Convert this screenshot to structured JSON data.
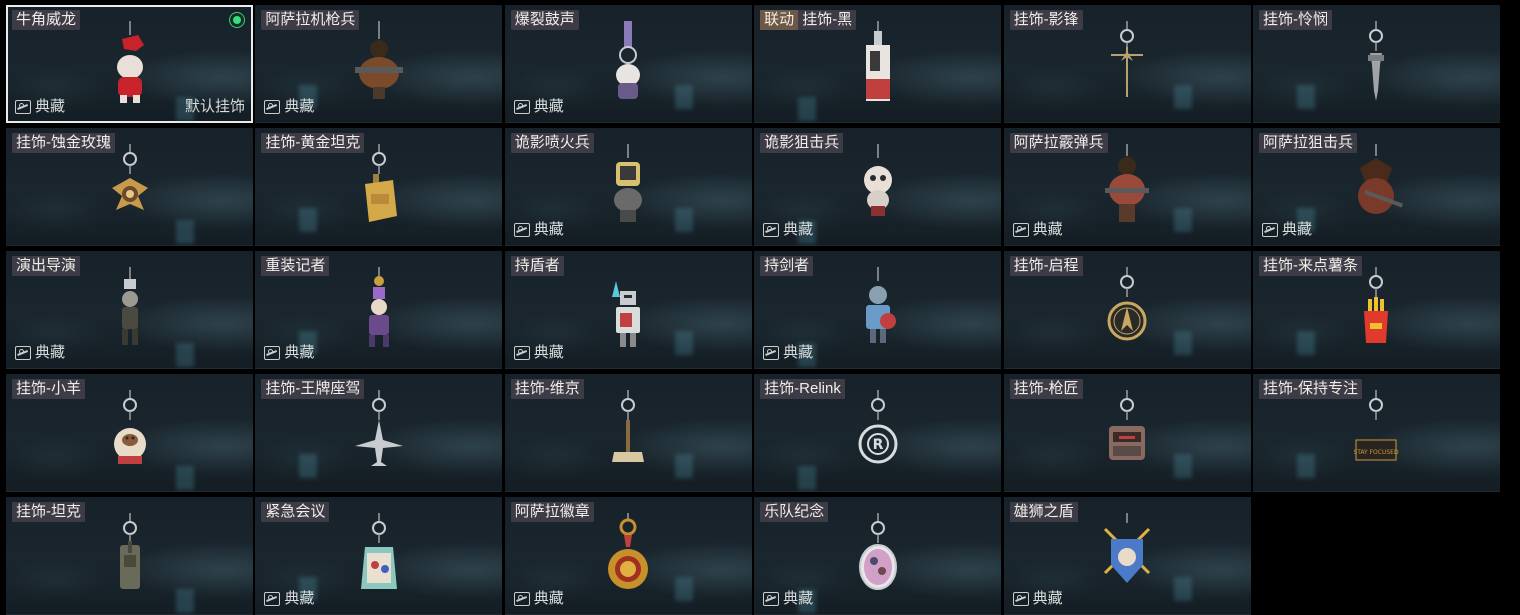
{
  "badge_text": "典藏",
  "default_text": "默认挂饰",
  "colors": {
    "selected_border": "#e9ecec",
    "equipped_dot": "#34e07f",
    "name_bg": "#48424e",
    "collab_tag_bg": "#6b5848"
  },
  "items": [
    {
      "name": "牛角威龙",
      "collection": true,
      "default": true,
      "selected": true,
      "equipped": true,
      "icon": "dragon-charm-icon",
      "color": "#c8232b"
    },
    {
      "name": "阿萨拉机枪兵",
      "collection": true,
      "icon": "gunner-charm-icon",
      "color": "#7a4a2a"
    },
    {
      "name": "爆裂鼓声",
      "collection": true,
      "icon": "drummer-charm-icon",
      "color": "#8a7ab8"
    },
    {
      "name": "挂饰-黑",
      "tag": "联动",
      "collection": false,
      "icon": "card-charm-icon",
      "color": "#c04040"
    },
    {
      "name": "挂饰-影锋",
      "collection": false,
      "icon": "blade-charm-icon",
      "color": "#b8a070"
    },
    {
      "name": "挂饰-怜悯",
      "collection": false,
      "icon": "dagger-charm-icon",
      "color": "#a0a4a8"
    },
    {
      "name": "挂饰-蚀金玫瑰",
      "collection": false,
      "icon": "rose-charm-icon",
      "color": "#c89a4a"
    },
    {
      "name": "挂饰-黄金坦克",
      "collection": false,
      "icon": "gold-tank-charm-icon",
      "color": "#d4a94a"
    },
    {
      "name": "诡影喷火兵",
      "collection": true,
      "icon": "flamer-charm-icon",
      "color": "#d8c070"
    },
    {
      "name": "诡影狙击兵",
      "collection": true,
      "icon": "sniper-ghost-charm-icon",
      "color": "#e8e0d8"
    },
    {
      "name": "阿萨拉霰弹兵",
      "collection": true,
      "icon": "shotgunner-charm-icon",
      "color": "#9a4a3a"
    },
    {
      "name": "阿萨拉狙击兵",
      "collection": true,
      "icon": "sniper-charm-icon",
      "color": "#7a3a2a"
    },
    {
      "name": "演出导演",
      "collection": true,
      "icon": "director-charm-icon",
      "color": "#9a9a90"
    },
    {
      "name": "重装记者",
      "collection": true,
      "icon": "reporter-charm-icon",
      "color": "#9a6ac8"
    },
    {
      "name": "持盾者",
      "collection": true,
      "icon": "shield-bearer-charm-icon",
      "color": "#c8ccd0"
    },
    {
      "name": "持剑者",
      "collection": true,
      "icon": "sword-bearer-charm-icon",
      "color": "#6a9ac8"
    },
    {
      "name": "挂饰-启程",
      "collection": false,
      "icon": "compass-charm-icon",
      "color": "#c8a860"
    },
    {
      "name": "挂饰-来点薯条",
      "collection": false,
      "icon": "fries-charm-icon",
      "color": "#e03a2a"
    },
    {
      "name": "挂饰-小羊",
      "collection": false,
      "icon": "sheep-charm-icon",
      "color": "#e8dcc8"
    },
    {
      "name": "挂饰-王牌座驾",
      "collection": false,
      "icon": "jet-charm-icon",
      "color": "#c8ccd0"
    },
    {
      "name": "挂饰-维京",
      "collection": false,
      "icon": "hammer-charm-icon",
      "color": "#d8c8a0"
    },
    {
      "name": "挂饰-Relink",
      "collection": false,
      "icon": "relink-charm-icon",
      "color": "#d8dce0"
    },
    {
      "name": "挂饰-枪匠",
      "collection": false,
      "icon": "toolbox-charm-icon",
      "color": "#8a6a60"
    },
    {
      "name": "挂饰-保持专注",
      "collection": false,
      "icon": "focus-tag-charm-icon",
      "color": "#c89a40"
    },
    {
      "name": "挂饰-坦克",
      "collection": false,
      "icon": "tank-charm-icon",
      "color": "#6a6a5a"
    },
    {
      "name": "紧急会议",
      "collection": true,
      "icon": "meeting-charm-icon",
      "color": "#8ac8c0"
    },
    {
      "name": "阿萨拉徽章",
      "collection": true,
      "icon": "medal-charm-icon",
      "color": "#c8902a"
    },
    {
      "name": "乐队纪念",
      "collection": true,
      "icon": "band-charm-icon",
      "color": "#d0a0c8"
    },
    {
      "name": "雄狮之盾",
      "collection": true,
      "icon": "lion-shield-charm-icon",
      "color": "#4a7ac8"
    }
  ]
}
